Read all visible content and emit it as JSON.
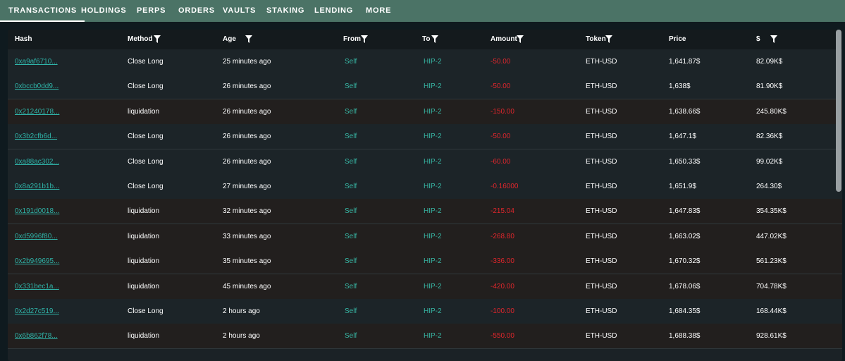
{
  "tabs": [
    "TRANSACTIONS",
    "HOLDINGS",
    "PERPS",
    "ORDERS",
    "VAULTS",
    "STAKING",
    "LENDING",
    "MORE"
  ],
  "active_tab": "TRANSACTIONS",
  "columns": {
    "hash": "Hash",
    "method": "Method",
    "age": "Age",
    "from": "From",
    "to": "To",
    "amount": "Amount",
    "token": "Token",
    "price": "Price",
    "usd": "$"
  },
  "rows": [
    {
      "hash": "0xa9af6710...",
      "method": "Close Long",
      "age": "25 minutes ago",
      "from": "Self",
      "to": "HIP-2",
      "amount": "-50.00",
      "token": "ETH-USD",
      "price": "1,641.87$",
      "usd": "82.09K$"
    },
    {
      "hash": "0xbccb0dd9...",
      "method": "Close Long",
      "age": "26 minutes ago",
      "from": "Self",
      "to": "HIP-2",
      "amount": "-50.00",
      "token": "ETH-USD",
      "price": "1,638$",
      "usd": "81.90K$"
    },
    {
      "hash": "0x21240178...",
      "method": "liquidation",
      "age": "26 minutes ago",
      "from": "Self",
      "to": "HIP-2",
      "amount": "-150.00",
      "token": "ETH-USD",
      "price": "1,638.66$",
      "usd": "245.80K$"
    },
    {
      "hash": "0x3b2cfb6d...",
      "method": "Close Long",
      "age": "26 minutes ago",
      "from": "Self",
      "to": "HIP-2",
      "amount": "-50.00",
      "token": "ETH-USD",
      "price": "1,647.1$",
      "usd": "82.36K$"
    },
    {
      "hash": "0xa88ac302...",
      "method": "Close Long",
      "age": "26 minutes ago",
      "from": "Self",
      "to": "HIP-2",
      "amount": "-60.00",
      "token": "ETH-USD",
      "price": "1,650.33$",
      "usd": "99.02K$"
    },
    {
      "hash": "0x8a291b1b...",
      "method": "Close Long",
      "age": "27 minutes ago",
      "from": "Self",
      "to": "HIP-2",
      "amount": "-0.16000",
      "token": "ETH-USD",
      "price": "1,651.9$",
      "usd": "264.30$"
    },
    {
      "hash": "0x191d0018...",
      "method": "liquidation",
      "age": "32 minutes ago",
      "from": "Self",
      "to": "HIP-2",
      "amount": "-215.04",
      "token": "ETH-USD",
      "price": "1,647.83$",
      "usd": "354.35K$"
    },
    {
      "hash": "0xd5996f80...",
      "method": "liquidation",
      "age": "33 minutes ago",
      "from": "Self",
      "to": "HIP-2",
      "amount": "-268.80",
      "token": "ETH-USD",
      "price": "1,663.02$",
      "usd": "447.02K$"
    },
    {
      "hash": "0x2b949695...",
      "method": "liquidation",
      "age": "35 minutes ago",
      "from": "Self",
      "to": "HIP-2",
      "amount": "-336.00",
      "token": "ETH-USD",
      "price": "1,670.32$",
      "usd": "561.23K$"
    },
    {
      "hash": "0x331bec1a...",
      "method": "liquidation",
      "age": "45 minutes ago",
      "from": "Self",
      "to": "HIP-2",
      "amount": "-420.00",
      "token": "ETH-USD",
      "price": "1,678.06$",
      "usd": "704.78K$"
    },
    {
      "hash": "0x2d27c519...",
      "method": "Close Long",
      "age": "2 hours ago",
      "from": "Self",
      "to": "HIP-2",
      "amount": "-100.00",
      "token": "ETH-USD",
      "price": "1,684.35$",
      "usd": "168.44K$"
    },
    {
      "hash": "0x6b862f78...",
      "method": "liquidation",
      "age": "2 hours ago",
      "from": "Self",
      "to": "HIP-2",
      "amount": "-550.00",
      "token": "ETH-USD",
      "price": "1,688.38$",
      "usd": "928.61K$"
    }
  ],
  "colors": {
    "tabbar": "#4b7366",
    "link": "#2fb3a8",
    "teal": "#37b6a4",
    "negative": "#e0262c"
  }
}
